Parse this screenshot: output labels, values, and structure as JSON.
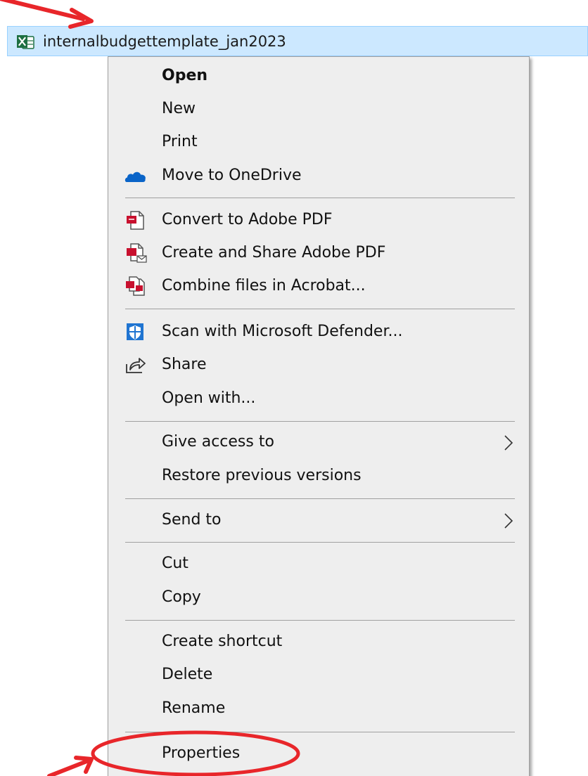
{
  "file": {
    "name": "internalbudgettemplate_jan2023",
    "icon": "excel-file-icon"
  },
  "menu": {
    "items": [
      {
        "key": "open",
        "label": "Open",
        "bold": true
      },
      {
        "key": "new",
        "label": "New"
      },
      {
        "key": "print",
        "label": "Print"
      },
      {
        "key": "move-to-onedrive",
        "label": "Move to OneDrive",
        "icon": "onedrive-cloud-icon"
      },
      {
        "key": "convert-to-adobe-pdf",
        "label": "Convert to Adobe PDF",
        "icon": "adobe-pdf-convert-icon"
      },
      {
        "key": "create-and-share-adobe-pdf",
        "label": "Create and Share Adobe PDF",
        "icon": "adobe-pdf-share-icon"
      },
      {
        "key": "combine-files-in-acrobat",
        "label": "Combine files in Acrobat...",
        "icon": "adobe-pdf-combine-icon"
      },
      {
        "key": "scan-with-microsoft-defender",
        "label": "Scan with Microsoft Defender...",
        "icon": "defender-shield-icon"
      },
      {
        "key": "share",
        "label": "Share",
        "icon": "share-icon"
      },
      {
        "key": "open-with",
        "label": "Open with..."
      },
      {
        "key": "give-access-to",
        "label": "Give access to",
        "submenu": true
      },
      {
        "key": "restore-previous-versions",
        "label": "Restore previous versions"
      },
      {
        "key": "send-to",
        "label": "Send to",
        "submenu": true
      },
      {
        "key": "cut",
        "label": "Cut"
      },
      {
        "key": "copy",
        "label": "Copy"
      },
      {
        "key": "create-shortcut",
        "label": "Create shortcut"
      },
      {
        "key": "delete",
        "label": "Delete"
      },
      {
        "key": "rename",
        "label": "Rename"
      },
      {
        "key": "properties",
        "label": "Properties",
        "highlighted": true
      }
    ]
  },
  "colors": {
    "selection": "#cce8ff",
    "menu_bg": "#eeeeee",
    "annotation": "#e8262a",
    "excel_green": "#1d6f42",
    "onedrive_blue": "#0a64c8",
    "adobe_red": "#c8102e",
    "defender_blue": "#1f74d1"
  }
}
